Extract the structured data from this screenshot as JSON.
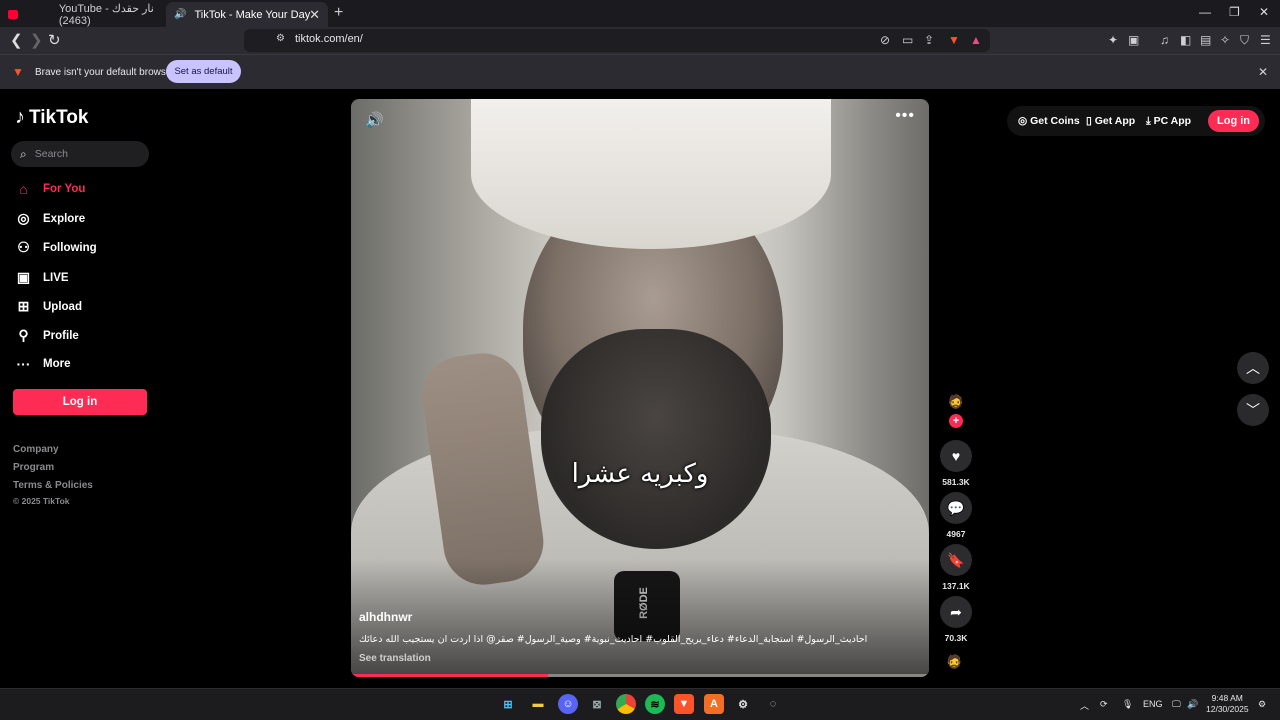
{
  "browser": {
    "tabs": [
      {
        "title": "YouTube - نار حقدك (2463)",
        "active": false,
        "icon": "youtube-icon"
      },
      {
        "title": "TikTok - Make Your Day",
        "active": true,
        "icon": "speaker-icon"
      }
    ],
    "url": "tiktok.com/en/",
    "infobar_text": "Brave isn't your default browser",
    "set_default_label": "Set as default",
    "accent": "#fe2c55"
  },
  "sidebar": {
    "logo_text": "TikTok",
    "search_placeholder": "Search",
    "nav": [
      {
        "label": "For You",
        "icon": "home-icon",
        "active": true
      },
      {
        "label": "Explore",
        "icon": "compass-icon",
        "active": false
      },
      {
        "label": "Following",
        "icon": "following-icon",
        "active": false
      },
      {
        "label": "LIVE",
        "icon": "live-icon",
        "active": false
      },
      {
        "label": "Upload",
        "icon": "upload-icon",
        "active": false
      },
      {
        "label": "Profile",
        "icon": "profile-icon",
        "active": false
      },
      {
        "label": "More",
        "icon": "more-icon",
        "active": false
      }
    ],
    "login_label": "Log in",
    "footer_links": [
      "Company",
      "Program",
      "Terms & Policies"
    ],
    "copyright": "© 2025 TikTok"
  },
  "video": {
    "caption": "وكبريه عشرا",
    "author": "alhdhnwr",
    "description": "احاديث_الرسول# استجابة_الدعاء# دعاء_يريح_القلوب# احاديث_نبوية# وصية_الرسول# صقر@ اذا اردت ان يستجيب الله دعائك",
    "see_translation": "See translation",
    "progress": 0.34
  },
  "actions": {
    "likes": "581.3K",
    "comments": "4967",
    "saves": "137.1K",
    "shares": "70.3K"
  },
  "topright": {
    "get_coins": "Get Coins",
    "get_app": "Get App",
    "pc_app": "PC App",
    "login": "Log in"
  },
  "taskbar": {
    "language": "ENG",
    "time": "9:48 AM",
    "date": "12/30/2025"
  }
}
